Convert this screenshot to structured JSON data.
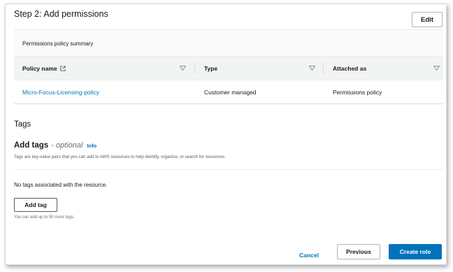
{
  "step": {
    "title": "Step 2: Add permissions",
    "edit_label": "Edit"
  },
  "permissions": {
    "summary_title": "Permissions policy summary",
    "columns": [
      "Policy name",
      "Type",
      "Attached as"
    ],
    "rows": [
      {
        "policy_name": "Micro-Focus-Licensing-policy",
        "type": "Customer managed",
        "attached_as": "Permissions policy"
      }
    ]
  },
  "tags": {
    "heading": "Tags",
    "add_title": "Add tags",
    "optional": "- optional",
    "info": "Info",
    "description": "Tags are key-value pairs that you can add to AWS resources to help identify, organize, or search for resources.",
    "empty_message": "No tags associated with the resource.",
    "add_tag_label": "Add tag",
    "hint": "You can add up to 50 more tags."
  },
  "footer": {
    "cancel_label": "Cancel",
    "previous_label": "Previous",
    "create_label": "Create role"
  },
  "colors": {
    "link": "#0073bb",
    "primary_button": "#0073bb",
    "header_bg": "#f2f3f3"
  }
}
